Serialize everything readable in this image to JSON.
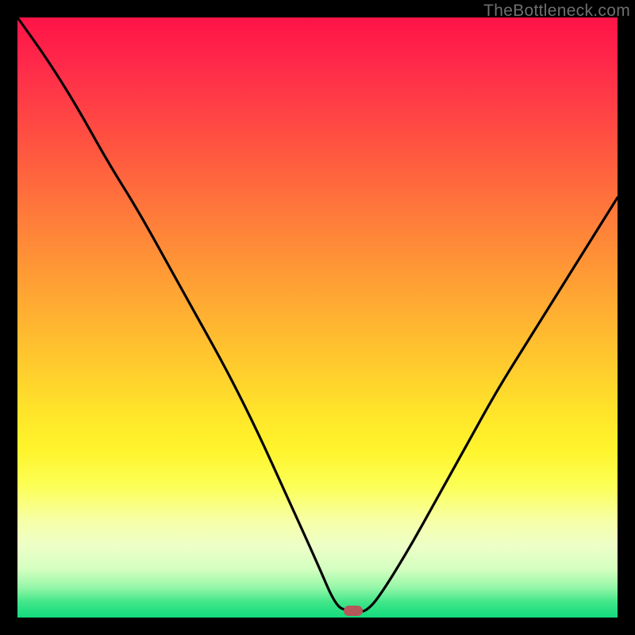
{
  "watermark": "TheBottleneck.com",
  "colors": {
    "frame": "#000000",
    "curve": "#000000",
    "marker": "#b6575a"
  },
  "chart_data": {
    "type": "line",
    "title": "",
    "xlabel": "",
    "ylabel": "",
    "xlim": [
      0,
      100
    ],
    "ylim": [
      0,
      100
    ],
    "note": "Axes have no visible tick labels; x/y are normalized 0–100 across the plot area. y represents bottleneck mismatch (0 = green/optimal, 100 = red/worst).",
    "series": [
      {
        "name": "bottleneck-curve",
        "x": [
          0,
          5,
          10,
          15,
          20,
          25,
          30,
          35,
          40,
          45,
          50,
          53,
          55,
          57,
          58,
          60,
          65,
          70,
          75,
          80,
          85,
          90,
          95,
          100
        ],
        "y": [
          100,
          93,
          85,
          76,
          68,
          59,
          50,
          41,
          31,
          20,
          9,
          2,
          0,
          0,
          0,
          3,
          11,
          20,
          29,
          38,
          46,
          54,
          62,
          70
        ]
      }
    ],
    "marker": {
      "x": 56,
      "y": 0,
      "meaning": "optimal point (minimum bottleneck)"
    },
    "background_gradient": {
      "orientation": "vertical",
      "stops": [
        {
          "pos": 0.0,
          "color": "#ff1347"
        },
        {
          "pos": 0.22,
          "color": "#ff5640"
        },
        {
          "pos": 0.46,
          "color": "#ffa533"
        },
        {
          "pos": 0.72,
          "color": "#fff42c"
        },
        {
          "pos": 0.88,
          "color": "#edffc7"
        },
        {
          "pos": 1.0,
          "color": "#12db7e"
        }
      ]
    }
  }
}
